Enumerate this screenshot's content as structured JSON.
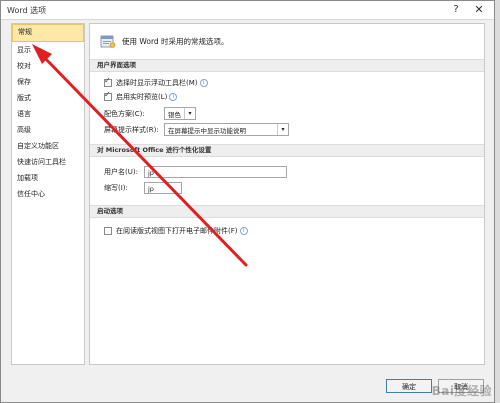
{
  "window": {
    "title": "Word 选项",
    "help_icon": "question-mark-icon",
    "close_icon": "close-icon"
  },
  "sidebar": {
    "items": [
      {
        "label": "常规",
        "selected": true
      },
      {
        "label": "显示"
      },
      {
        "label": "校对"
      },
      {
        "label": "保存"
      },
      {
        "label": "版式"
      },
      {
        "label": "语言"
      },
      {
        "label": "高级"
      },
      {
        "label": "自定义功能区"
      },
      {
        "label": "快速访问工具栏"
      },
      {
        "label": "加载项"
      },
      {
        "label": "信任中心"
      }
    ]
  },
  "main": {
    "intro_text": "使用 Word 时采用的常规选项。",
    "ui_section": {
      "heading": "用户界面选项",
      "show_mini_toolbar": "选择时显示浮动工具栏(M)",
      "live_preview": "启用实时预览(L)",
      "color_scheme_label": "配色方案(C):",
      "color_scheme_value": "银色",
      "screentip_label": "屏幕提示样式(R):",
      "screentip_value": "在屏幕提示中显示功能说明"
    },
    "personalize_section": {
      "heading": "对 Microsoft Office 进行个性化设置",
      "username_label": "用户名(U):",
      "username_value": "jp",
      "initials_label": "缩写(I):",
      "initials_value": "jp"
    },
    "startup_section": {
      "heading": "启动选项",
      "open_reading_view": "在阅读版式视图下打开电子邮件附件(F)"
    }
  },
  "footer": {
    "ok_label": "确定",
    "cancel_label": "取消"
  },
  "watermark": "Bai度经验",
  "colors": {
    "selected_bg": "#fde8a6",
    "arrow": "#e02020"
  }
}
